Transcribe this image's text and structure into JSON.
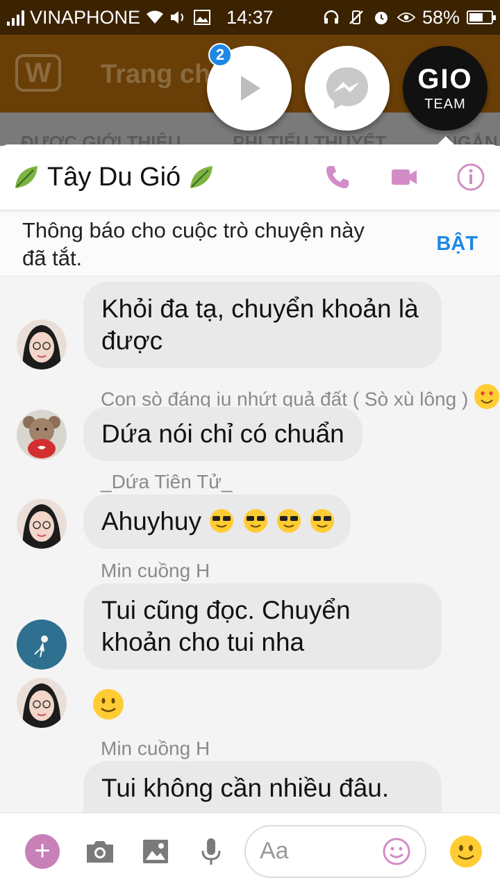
{
  "status": {
    "carrier": "VINAPHONE",
    "time": "14:37",
    "battery": "58%"
  },
  "background_app": {
    "title": "Trang ch",
    "tabs": [
      "ĐƯỢC GIỚI THIỆU",
      "PHI TIỂU THUYẾT",
      "NGẮN"
    ]
  },
  "chat_heads": {
    "badge_count": "2",
    "team_logo": "GIO",
    "team_label": "TEAM"
  },
  "chat": {
    "title": "Tây Du Gió",
    "notice": "Thông báo cho cuộc trò chuyện này đã tắt.",
    "notice_action": "BẬT"
  },
  "messages": [
    {
      "sender": "",
      "text": "Khỏi đa tạ, chuyển khoản là được"
    },
    {
      "sender": "Con sò đáng iu nhứt quả đất ( Sò xù lông )",
      "text": "Dứa nói chỉ có chuẩn"
    },
    {
      "sender": "_Dứa Tiên Tử_",
      "text": "Ahuyhuy"
    },
    {
      "sender": "Min cuồng H",
      "text": "Tui cũng đọc. Chuyển khoản cho tui nha"
    },
    {
      "sender": "",
      "text": ""
    },
    {
      "sender": "Min cuồng H",
      "text": "Tui không cần nhiều đâu."
    }
  ],
  "composer": {
    "placeholder": "Aa"
  },
  "colors": {
    "accent": "#c780b8",
    "link": "#1e88e5",
    "bubble": "#e9e9e9"
  }
}
